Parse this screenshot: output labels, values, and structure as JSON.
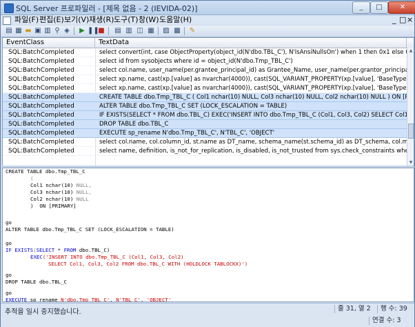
{
  "window": {
    "title": "SQL Server 프로파일러 - [제목 없음 - 2 (IEVIDA-02)]"
  },
  "menu": [
    {
      "label": "파일(F)"
    },
    {
      "label": "편집(E)"
    },
    {
      "label": "보기(V)"
    },
    {
      "label": "재생(R)"
    },
    {
      "label": "도구(T)"
    },
    {
      "label": "창(W)"
    },
    {
      "label": "도움말(H)"
    }
  ],
  "toolbar_icons": [
    "new-trace-icon",
    "new-template-icon",
    "open-icon",
    "save-icon",
    "properties-icon",
    "find-icon",
    "clear-icon",
    "run-icon",
    "pause-icon",
    "stop-icon",
    "auto-scroll-icon",
    "columns-icon",
    "split-icon",
    "grid-icon",
    "activity-icon",
    "performance-icon",
    "help-icon"
  ],
  "grid": {
    "columns": [
      "EventClass",
      "TextData"
    ],
    "rows": [
      {
        "event": "SQL:BatchCompleted",
        "text": "select convert(int, case ObjectProperty(object_id(N'dbo.TBL_C'), N'IsAnsiNullsOn') when 1 then 0x1 else 0x0 end)",
        "selected": false
      },
      {
        "event": "SQL:BatchCompleted",
        "text": "select id from sysobjects where id = object_id(N'dbo.Tmp_TBL_C')",
        "selected": false
      },
      {
        "event": "SQL:BatchCompleted",
        "text": "select col.name, user_name(per.grantee_principal_id) as Grantee_Name, user_name(per.grantor_principal_id) as Grant",
        "selected": false
      },
      {
        "event": "SQL:BatchCompleted",
        "text": "select xp.name, cast(xp.[value] as nvarchar(4000)), cast(SQL_VARIANT_PROPERTY(xp.[value], 'BaseType') as nvarchar(",
        "selected": false
      },
      {
        "event": "SQL:BatchCompleted",
        "text": " select xp.name, cast(xp.[value] as nvarchar(4000)), cast(SQL_VARIANT_PROPERTY(xp.[value], 'BaseType') as nvarchar",
        "selected": false
      },
      {
        "event": "SQL:BatchCompleted",
        "text": "CREATE TABLE dbo.Tmp_TBL_C   (    Col1 nchar(10) NULL,    Col3 nchar(10) NULL,    Col2 nchar(10) NULL    )  ON [PRIMAR",
        "selected": true
      },
      {
        "event": "SQL:BatchCompleted",
        "text": "ALTER TABLE dbo.Tmp_TBL_C SET (LOCK_ESCALATION = TABLE)",
        "selected": true
      },
      {
        "event": "SQL:BatchCompleted",
        "text": "IF EXISTS(SELECT * FROM dbo.TBL_C)     EXEC('INSERT INTO dbo.Tmp_TBL_C (Col1, Col3, Col2)     SELECT Col1, Col3, Col",
        "selected": true
      },
      {
        "event": "SQL:BatchCompleted",
        "text": "DROP TABLE dbo.TBL_C",
        "selected": true
      },
      {
        "event": "SQL:BatchCompleted",
        "text": "EXECUTE sp_rename N'dbo.Tmp_TBL_C', N'TBL_C', 'OBJECT'",
        "selected": true
      },
      {
        "event": "SQL:BatchCompleted",
        "text": "select col.name, col.column_id, st.name as DT_name, schema_name(st.schema_id) as DT_schema, col.max_length, col.pr",
        "selected": false
      },
      {
        "event": "SQL:BatchCompleted",
        "text": "select  name, definition, is_not_for_replication, is_disabled, is_not_trusted from sys.check_constraints where pa",
        "selected": false
      }
    ]
  },
  "code": {
    "l1": "CREATE TABLE dbo.Tmp_TBL_C",
    "l2": "(",
    "l3a": "Col1 nchar(10) ",
    "l3b": "NULL,",
    "l4a": "Col3 nchar(10) ",
    "l4b": "NULL,",
    "l5a": "Col2 nchar(10) ",
    "l5b": "NULL",
    "l6": ")  ON [PRIMARY]",
    "go1": "go",
    "alter": "ALTER TABLE dbo.Tmp_TBL_C SET (LOCK_ESCALATION = TABLE)",
    "go2": "go",
    "if_a": "IF ",
    "if_b": "EXISTS",
    "if_c": "(",
    "if_d": "SELECT",
    "if_e": " * ",
    "if_f": "FROM",
    "if_g": " dbo.TBL_C)",
    "exec_a": "EXEC",
    "exec_b": "('INSERT INTO dbo.Tmp_TBL_C (Col1, Col3, Col2)",
    "sel_line": "SELECT Col1, Col3, Col2 FROM dbo.TBL_C WITH (HOLDLOCK TABLOCKX)')",
    "go3": "go",
    "drop": "DROP TABLE dbo.TBL_C",
    "go4": "go",
    "execute_a": "EXECUTE",
    "execute_b": " sp_rename ",
    "execute_c": "N'dbo.Tmp_TBL_C'",
    "execute_d": ", ",
    "execute_e": "N'TBL_C'",
    "execute_f": ", ",
    "execute_g": "'OBJECT'",
    "go5": "go"
  },
  "status": {
    "message": "추적을 일시 중지했습니다.",
    "position": "줄 31, 열 2",
    "rows": "행 수: 39",
    "connections": "연결 수: 3"
  }
}
